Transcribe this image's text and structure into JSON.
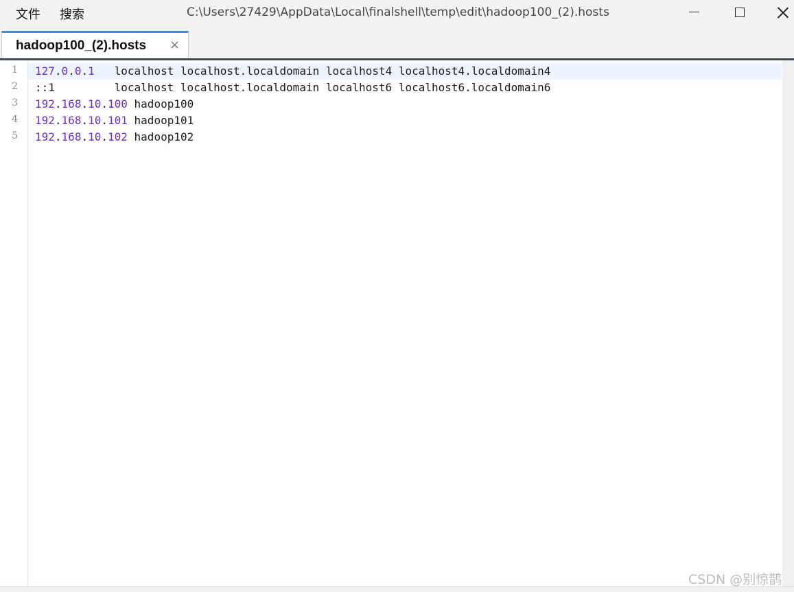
{
  "menu": {
    "file": "文件",
    "search": "搜索"
  },
  "window": {
    "title": "C:\\Users\\27429\\AppData\\Local\\finalshell\\temp\\edit\\hadoop100_(2).hosts"
  },
  "tab": {
    "label": "hadoop100_(2).hosts",
    "close": "×"
  },
  "editor": {
    "lines": [
      {
        "number": "1",
        "ip_parts": [
          "127",
          "0",
          "0",
          "1"
        ],
        "rest": "   localhost localhost.localdomain localhost4 localhost4.localdomain4"
      },
      {
        "number": "2",
        "plain": "::1         localhost localhost.localdomain localhost6 localhost6.localdomain6"
      },
      {
        "number": "3",
        "ip_parts": [
          "192",
          "168",
          "10",
          "100"
        ],
        "rest": " hadoop100"
      },
      {
        "number": "4",
        "ip_parts": [
          "192",
          "168",
          "10",
          "101"
        ],
        "rest": " hadoop101"
      },
      {
        "number": "5",
        "ip_parts": [
          "192",
          "168",
          "10",
          "102"
        ],
        "rest": " hadoop102"
      }
    ]
  },
  "watermark": "CSDN @别惊鹊",
  "colors": {
    "ip_number": "#6b2fc6",
    "active_tab_accent": "#3b8de0",
    "active_line": "#eef4fd"
  },
  "icons": {
    "minimize": "minimize-icon",
    "maximize": "maximize-icon",
    "close": "close-icon"
  }
}
